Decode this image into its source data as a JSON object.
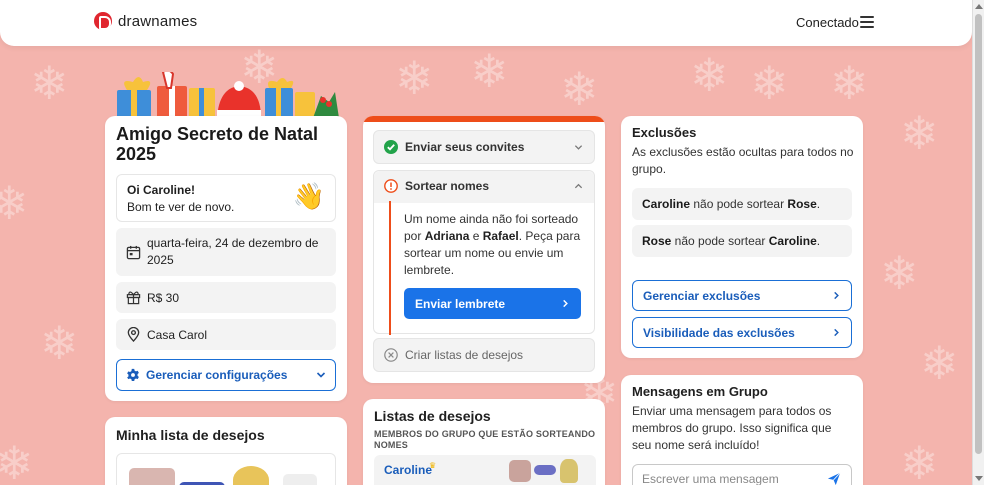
{
  "colors": {
    "background": "#f4b4ad",
    "accent_blue": "#1a73e8",
    "accent_orange": "#ee4d1a",
    "success_green": "#22a34a",
    "brand_red": "#e0262f"
  },
  "header": {
    "brand": "drawnames",
    "status": "Conectado",
    "menu_icon": "hamburger-icon"
  },
  "event": {
    "title": "Amigo Secreto de Natal 2025",
    "greeting": {
      "hello": "Oi Caroline!",
      "message": "Bom te ver de novo.",
      "emoji": "👋"
    },
    "date": "quarta-feira, 24 de dezembro de 2025",
    "budget": "R$ 30",
    "location": "Casa Carol",
    "manage_label": "Gerenciar configurações"
  },
  "my_wishlist": {
    "title": "Minha lista de desejos"
  },
  "steps": {
    "step1": {
      "label": "Enviar seus convites",
      "status": "done"
    },
    "step2": {
      "label": "Sortear nomes",
      "status": "attention",
      "text_1": "Um nome ainda não foi sorteado por ",
      "name_a": "Adriana",
      "text_2": " e ",
      "name_b": "Rafael",
      "text_3": ". Peça para sortear um nome ou envie um lembrete.",
      "button": "Enviar lembrete"
    },
    "step3": {
      "label": "Criar listas de desejos",
      "status": "blocked"
    }
  },
  "wishlists": {
    "title": "Listas de desejos",
    "subtitle": "MEMBROS DO GRUPO QUE ESTÃO SORTEANDO NOMES",
    "members": [
      {
        "name": "Caroline"
      }
    ]
  },
  "exclusions": {
    "title": "Exclusões",
    "description": "As exclusões estão ocultas para todos no grupo.",
    "items": [
      {
        "from": "Caroline",
        "text": " não pode sortear ",
        "to": "Rose",
        "end": "."
      },
      {
        "from": "Rose",
        "text": " não pode sortear ",
        "to": "Caroline",
        "end": "."
      }
    ],
    "manage_button": "Gerenciar exclusões",
    "visibility_button": "Visibilidade das exclusões"
  },
  "messages": {
    "title": "Mensagens em Grupo",
    "description": "Enviar uma mensagem para todos os membros do grupo. Isso significa que seu nome será incluído!",
    "placeholder": "Escrever uma mensagem"
  }
}
